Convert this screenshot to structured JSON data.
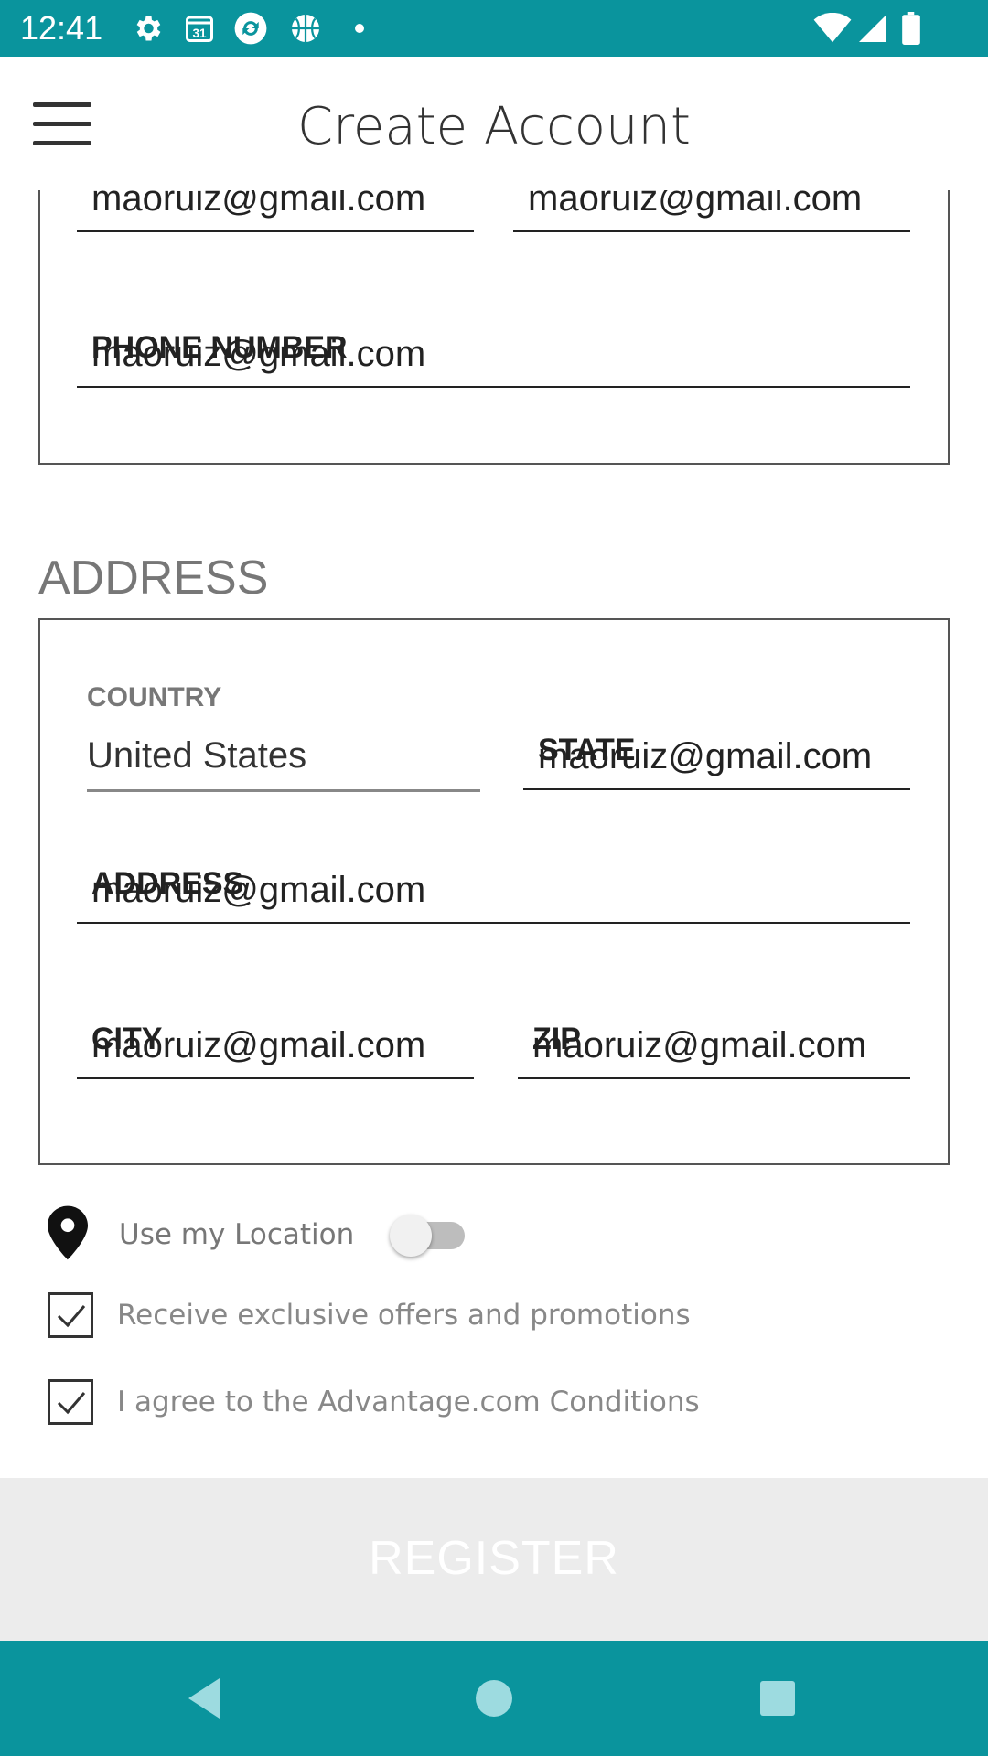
{
  "status_bar": {
    "time": "12:41",
    "icons": [
      "gear-icon",
      "calendar-icon",
      "sync-app-icon",
      "basketball-icon",
      "dot-icon",
      "wifi-icon",
      "signal-icon",
      "battery-icon"
    ],
    "calendar_day": "31"
  },
  "app_bar": {
    "title": "Create Account",
    "menu_icon": "hamburger-menu-icon"
  },
  "account_section": {
    "email_field_value": "maoruiz@gmail.com",
    "confirm_email_field_value": "maoruiz@gmail.com",
    "phone_label": "PHONE NUMBER",
    "phone_value": "maoruiz@gmail.com"
  },
  "address_section": {
    "title": "ADDRESS",
    "country_label": "COUNTRY",
    "country_value": "United States",
    "state_label": "STATE",
    "state_value": "maoruiz@gmail.com",
    "address_label": "ADDRESS",
    "address_value": "maoruiz@gmail.com",
    "city_label": "CITY",
    "city_value": "maoruiz@gmail.com",
    "zip_label": "ZIP",
    "zip_value": "maoruiz@gmail.com"
  },
  "options": {
    "use_location_label": "Use my Location",
    "use_location_on": false,
    "offers_label": "Receive exclusive offers and promotions",
    "offers_checked": true,
    "agree_label": "I agree to the Advantage.com Conditions",
    "agree_checked": true
  },
  "register_button": {
    "label": "REGISTER",
    "enabled": false
  },
  "nav_bar": {
    "back_icon": "back-triangle-icon",
    "home_icon": "home-circle-icon",
    "recents_icon": "recents-square-icon"
  },
  "colors": {
    "primary": "#0a949d",
    "nav_icon": "#9ddbe0",
    "register_bg": "#ececec"
  }
}
